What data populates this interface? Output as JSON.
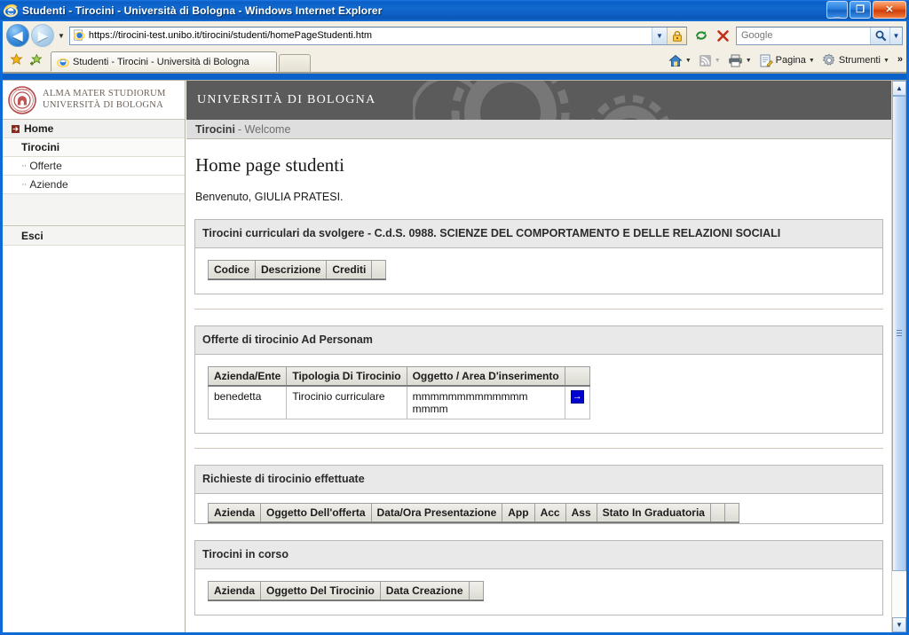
{
  "window": {
    "title": "Studenti - Tirocini - Università di Bologna - Windows Internet Explorer",
    "minimize_label": "_",
    "maximize_label": "❐",
    "close_label": "✕"
  },
  "browser": {
    "back_label": "◀",
    "forward_label": "▶",
    "history_caret": "▼",
    "address": {
      "url": "https://tirocini-test.unibo.it/tirocini/studenti/homePageStudenti.htm",
      "dropdown_caret": "▼",
      "lock_icon": "padlock-icon"
    },
    "refresh_icon": "refresh-icon",
    "stop_icon": "stop-icon",
    "search": {
      "placeholder": "Google",
      "go_icon": "magnifier-icon",
      "caret": "▼"
    },
    "favorites_icon": "star-icon",
    "add_favorite_icon": "add-star-icon",
    "tab": {
      "label": "Studenti - Tirocini - Università di Bologna"
    },
    "new_tab_label": "",
    "commands": [
      {
        "name": "home",
        "label": "",
        "icon": "home-icon",
        "caret": "▼"
      },
      {
        "name": "feeds",
        "label": "",
        "icon": "rss-icon",
        "caret": "▼"
      },
      {
        "name": "print",
        "label": "",
        "icon": "printer-icon",
        "caret": "▼"
      },
      {
        "name": "page",
        "label": "Pagina",
        "icon": "page-icon",
        "caret": "▼"
      },
      {
        "name": "tools",
        "label": "Strumenti",
        "icon": "gear-icon",
        "caret": "▼"
      }
    ],
    "overflow_label": "»"
  },
  "sidebar": {
    "logo": {
      "line1": "ALMA MATER STUDIORUM",
      "line2": "UNIVERSITÀ DI BOLOGNA",
      "seal_icon": "unibo-seal-icon"
    },
    "items": [
      {
        "label": "Home",
        "type": "home"
      },
      {
        "label": "Tirocini",
        "type": "section"
      },
      {
        "label": "Offerte",
        "type": "sub"
      },
      {
        "label": "Aziende",
        "type": "sub"
      }
    ],
    "logout": {
      "label": "Esci"
    }
  },
  "header": {
    "banner_title": "UNIVERSITÀ DI BOLOGNA",
    "breadcrumb_main": "Tirocini",
    "breadcrumb_sub": "- Welcome"
  },
  "main": {
    "page_title": "Home page studenti",
    "welcome": "Benvenuto, GIULIA PRATESI.",
    "panels": [
      {
        "id": "tirocini-curriculari",
        "heading": "Tirocini curriculari da svolgere - C.d.S. 0988. SCIENZE DEL COMPORTAMENTO E DELLE RELAZIONI SOCIALI",
        "columns": [
          "Codice",
          "Descrizione",
          "Crediti"
        ],
        "rows": []
      },
      {
        "id": "offerte-ad-personam",
        "heading": "Offerte di tirocinio Ad Personam",
        "columns": [
          "Azienda/Ente",
          "Tipologia Di Tirocinio",
          "Oggetto / Area D'inserimento"
        ],
        "rows": [
          {
            "azienda": "benedetta",
            "tipologia": "Tirocinio curriculare",
            "oggetto": "mmmmmmmmmmmmm mmmm",
            "action_icon": "arrow-right-icon"
          }
        ]
      },
      {
        "id": "richieste-effettuate",
        "heading": "Richieste di tirocinio effettuate",
        "columns": [
          "Azienda",
          "Oggetto Dell'offerta",
          "Data/Ora Presentazione",
          "App",
          "Acc",
          "Ass",
          "Stato In Graduatoria"
        ],
        "rows": []
      },
      {
        "id": "tirocini-in-corso",
        "heading": "Tirocini in corso",
        "columns": [
          "Azienda",
          "Oggetto Del Tirocinio",
          "Data Creazione"
        ],
        "rows": []
      }
    ]
  },
  "scrollbar": {
    "up_label": "▲",
    "down_label": "▼"
  },
  "colors": {
    "titlebar": "#0b5fc6",
    "banner": "#5b5b5b",
    "panel_header": "#e9e9e9",
    "action_button": "#0000d0",
    "separator": "#cfc7b4"
  }
}
